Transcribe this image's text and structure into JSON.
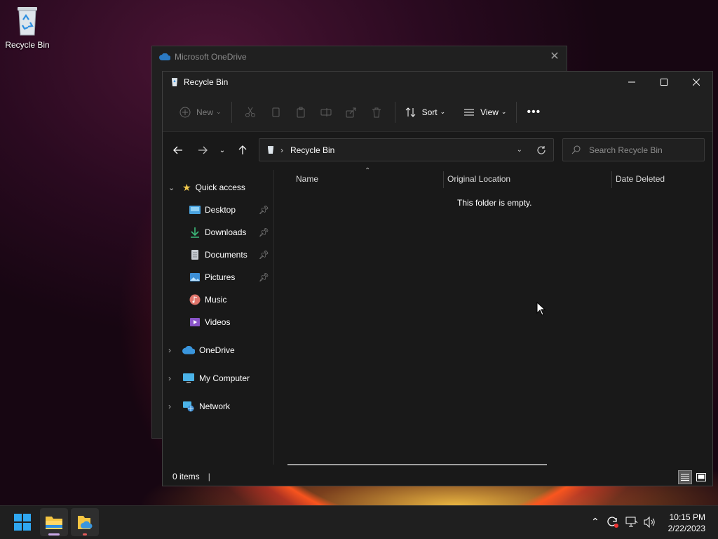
{
  "desktop": {
    "icons": [
      {
        "label": "Recycle Bin",
        "icon": "recycle-bin-icon"
      }
    ]
  },
  "background_window": {
    "title": "Microsoft OneDrive"
  },
  "explorer": {
    "title": "Recycle Bin",
    "toolbar": {
      "new_label": "New",
      "sort_label": "Sort",
      "view_label": "View"
    },
    "address": {
      "path": [
        "Recycle Bin"
      ]
    },
    "search": {
      "placeholder": "Search Recycle Bin"
    },
    "sidebar": {
      "quick_access": "Quick access",
      "pinned": [
        {
          "label": "Desktop",
          "icon": "desktop-folder-icon",
          "pinned": true
        },
        {
          "label": "Downloads",
          "icon": "downloads-icon",
          "pinned": true
        },
        {
          "label": "Documents",
          "icon": "documents-icon",
          "pinned": true
        },
        {
          "label": "Pictures",
          "icon": "pictures-icon",
          "pinned": true
        },
        {
          "label": "Music",
          "icon": "music-icon",
          "pinned": false
        },
        {
          "label": "Videos",
          "icon": "videos-icon",
          "pinned": false
        }
      ],
      "roots": [
        {
          "label": "OneDrive",
          "icon": "onedrive-cloud-icon"
        },
        {
          "label": "My Computer",
          "icon": "computer-icon"
        },
        {
          "label": "Network",
          "icon": "network-icon"
        }
      ]
    },
    "columns": [
      "Name",
      "Original Location",
      "Date Deleted"
    ],
    "empty_message": "This folder is empty.",
    "status": "0 items"
  },
  "taskbar": {
    "clock_time": "10:15 PM",
    "clock_date": "2/22/2023"
  },
  "colors": {
    "accent": "#3a96dd",
    "folder": "#f4c542",
    "window_bg": "#191919"
  }
}
